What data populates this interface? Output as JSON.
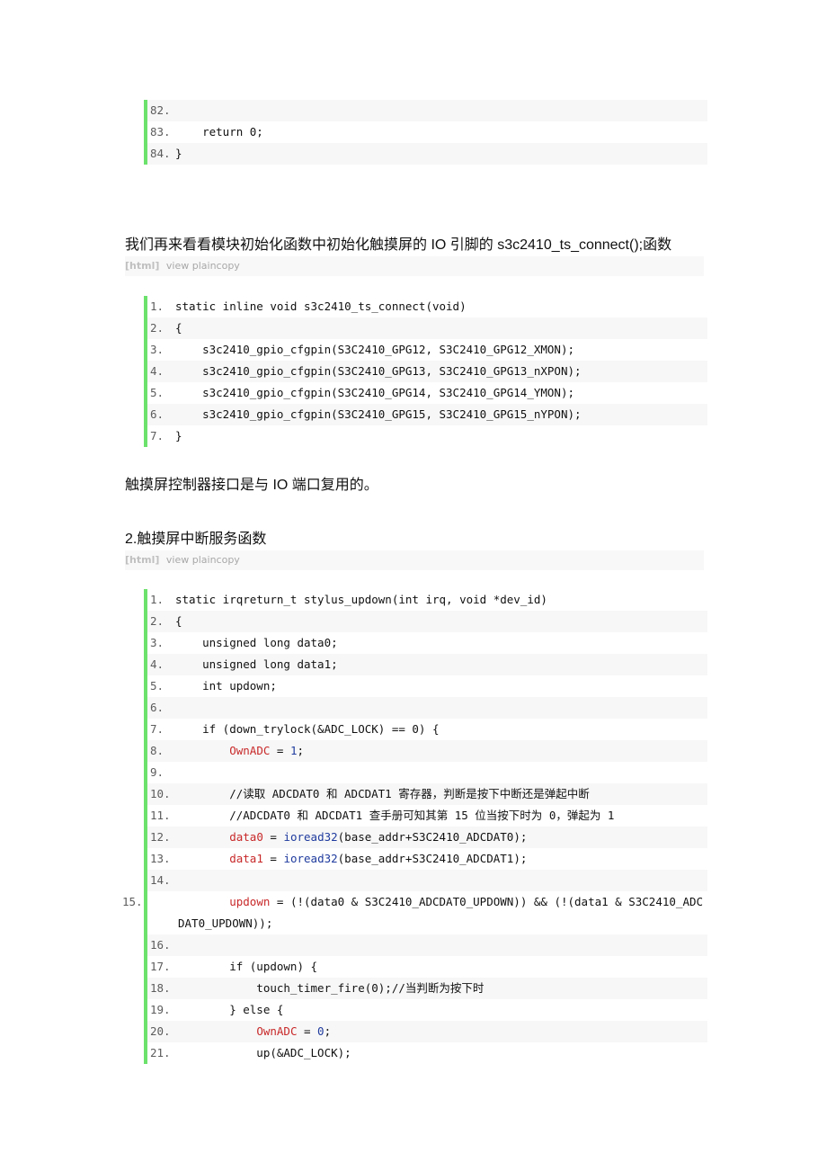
{
  "block1": {
    "lines": [
      {
        "num": "82.",
        "code": ""
      },
      {
        "num": "83.",
        "code": "    return 0;"
      },
      {
        "num": "84.",
        "code": "}"
      }
    ]
  },
  "paragraph1": "我们再来看看模块初始化函数中初始化触摸屏的 IO 引脚的 s3c2410_ts_connect();函数",
  "toolbar1": {
    "lang": "[html]",
    "view": "view",
    "plaincopy": "plaincopy"
  },
  "block2": {
    "lines": [
      {
        "num": "1.",
        "code": "static inline void s3c2410_ts_connect(void)"
      },
      {
        "num": "2.",
        "code": "{"
      },
      {
        "num": "3.",
        "code": "    s3c2410_gpio_cfgpin(S3C2410_GPG12, S3C2410_GPG12_XMON);"
      },
      {
        "num": "4.",
        "code": "    s3c2410_gpio_cfgpin(S3C2410_GPG13, S3C2410_GPG13_nXPON);"
      },
      {
        "num": "5.",
        "code": "    s3c2410_gpio_cfgpin(S3C2410_GPG14, S3C2410_GPG14_YMON);"
      },
      {
        "num": "6.",
        "code": "    s3c2410_gpio_cfgpin(S3C2410_GPG15, S3C2410_GPG15_nYPON);"
      },
      {
        "num": "7.",
        "code": "}"
      }
    ]
  },
  "paragraph2": "触摸屏控制器接口是与 IO 端口复用的。",
  "heading2": "2.触摸屏中断服务函数",
  "toolbar2": {
    "lang": "[html]",
    "view": "view",
    "plaincopy": "plaincopy"
  },
  "block3": {
    "lines": [
      {
        "num": "1.",
        "code": "static irqreturn_t stylus_updown(int irq, void *dev_id)"
      },
      {
        "num": "2.",
        "code": "{"
      },
      {
        "num": "3.",
        "code": "    unsigned long data0;"
      },
      {
        "num": "4.",
        "code": "    unsigned long data1;"
      },
      {
        "num": "5.",
        "code": "    int updown;"
      },
      {
        "num": "6.",
        "code": ""
      },
      {
        "num": "7.",
        "code": "    if (down_trylock(&ADC_LOCK) == 0) {"
      },
      {
        "num": "8.",
        "indent": "        ",
        "var": "OwnADC",
        "mid": " = ",
        "num_tok": "1",
        "tail": ";"
      },
      {
        "num": "9.",
        "code": ""
      },
      {
        "num": "10.",
        "code": "        //读取 ADCDAT0 和 ADCDAT1 寄存器，判断是按下中断还是弹起中断"
      },
      {
        "num": "11.",
        "code": "        //ADCDAT0 和 ADCDAT1 查手册可知其第 15 位当按下时为 0，弹起为 1"
      },
      {
        "num": "12.",
        "indent": "        ",
        "var": "data0",
        "mid": " = ",
        "fn": "ioread32",
        "tail": "(base_addr+S3C2410_ADCDAT0);"
      },
      {
        "num": "13.",
        "indent": "        ",
        "var": "data1",
        "mid": " = ",
        "fn": "ioread32",
        "tail": "(base_addr+S3C2410_ADCDAT1);"
      },
      {
        "num": "14.",
        "code": ""
      },
      {
        "num": "15.",
        "indent": "        ",
        "var": "updown",
        "tail": " = (!(data0 & S3C2410_ADCDAT0_UPDOWN)) && (!(data1 & S3C2410_ADCDAT0_UPDOWN));"
      },
      {
        "num": "16.",
        "code": ""
      },
      {
        "num": "17.",
        "code": "        if (updown) {"
      },
      {
        "num": "18.",
        "code": "            touch_timer_fire(0);//当判断为按下时"
      },
      {
        "num": "19.",
        "code": "        } else {"
      },
      {
        "num": "20.",
        "indent": "            ",
        "var": "OwnADC",
        "mid": " = ",
        "num_tok": "0",
        "tail": ";"
      },
      {
        "num": "21.",
        "code": "            up(&ADC_LOCK);"
      }
    ]
  },
  "colors": {
    "gutter_border": "#6ce26c",
    "variable": "#c82829",
    "function": "#1f3b9e",
    "number": "#1f3b9e",
    "toolbar_text": "#a8a8a8"
  }
}
